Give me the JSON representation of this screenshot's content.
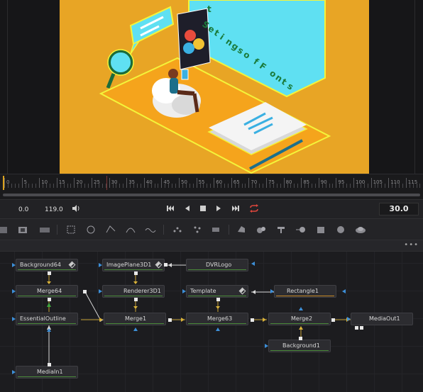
{
  "viewer": {
    "sign_letters": [
      "S",
      "e",
      "t",
      "i",
      "n",
      "g",
      "s",
      "o",
      "f",
      "F",
      "o",
      "n",
      "t",
      "s"
    ],
    "sign_top_letter": "t",
    "colors": {
      "background": "#e8a525",
      "floor": "#f5a41c",
      "screen": "#5fe0f2",
      "chair": "#eeeeee",
      "outline": "#f4f43a"
    }
  },
  "ruler": {
    "labels": [
      "0",
      "5",
      "10",
      "15",
      "20",
      "25",
      "30",
      "35",
      "40",
      "45",
      "50",
      "55",
      "60",
      "65",
      "70",
      "75",
      "80",
      "85",
      "90",
      "95",
      "100",
      "105",
      "110",
      "115"
    ]
  },
  "transport": {
    "start_time": "0.0",
    "end_field": "119.0",
    "current_time": "30.0",
    "buttons": [
      "speaker-icon",
      "skip-start-icon",
      "step-back-icon",
      "stop-icon",
      "play-icon",
      "skip-end-icon",
      "loop-icon"
    ]
  },
  "toolbar": {
    "tools": [
      "background-tool",
      "media-in-tool",
      "text-tool",
      "rectangle-mask-tool",
      "ellipse-mask-tool",
      "polygon-tool",
      "bspline-tool",
      "paint-tool",
      "particle-emitter-tool",
      "particle-render-tool",
      "particle-fx-tool",
      "shape3d-tool",
      "merge3d-tool",
      "text3d-tool",
      "renderer3d-tool",
      "camera3d-tool",
      "spotlight-tool",
      "imageplane-tool"
    ]
  },
  "node_editor": {
    "more_label": "•••",
    "nodes": {
      "background64": "Background64",
      "imageplane3d1": "ImagePlane3D1",
      "dvrlogo": "DVRLogo",
      "merge64": "Merge64",
      "renderer3d1": "Renderer3D1",
      "template": "Template",
      "rectangle1": "Rectangle1",
      "essentialoutline": "EssentialOutline",
      "merge1": "Merge1",
      "merge63": "Merge63",
      "merge2": "Merge2",
      "mediaout1": "MediaOut1",
      "background1": "Background1",
      "mediain1": "MediaIn1"
    }
  }
}
